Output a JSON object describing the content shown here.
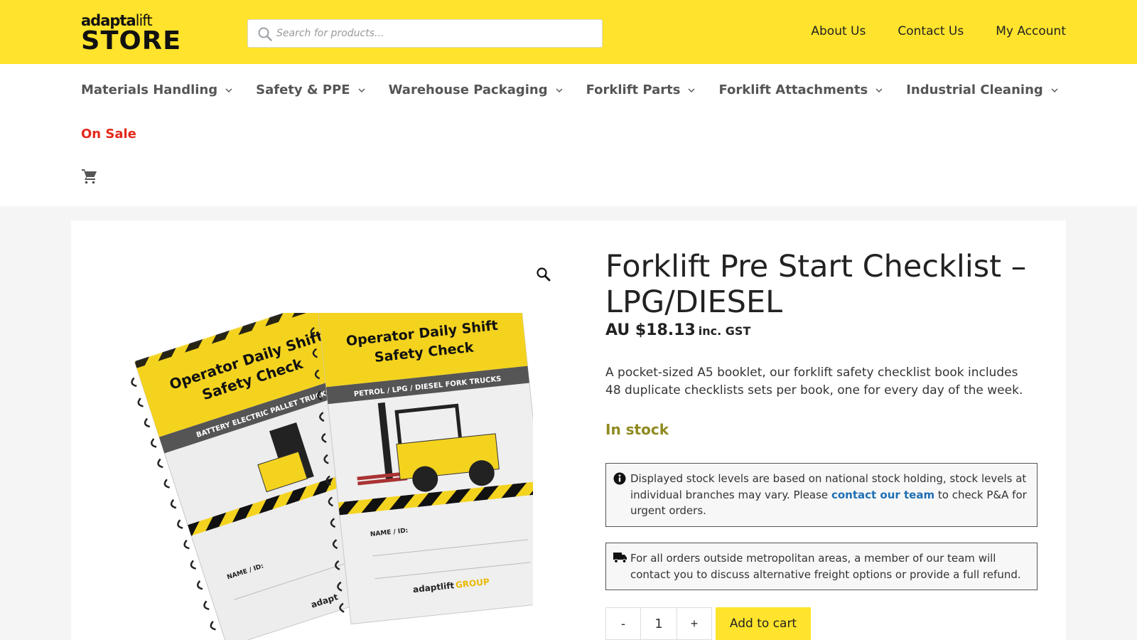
{
  "header": {
    "logo_top_bold": "adapta",
    "logo_top_thin": "lift",
    "logo_bottom": "STORE",
    "search_placeholder": "Search for products...",
    "links": [
      "About Us",
      "Contact Us",
      "My Account"
    ]
  },
  "nav": {
    "items": [
      "Materials Handling",
      "Safety & PPE",
      "Warehouse Packaging",
      "Forklift Parts",
      "Forklift Attachments",
      "Industrial Cleaning"
    ],
    "sale_label": "On Sale"
  },
  "product": {
    "title": "Forklift Pre Start Checklist – LPG/DIESEL",
    "price": "AU $18.13",
    "price_suffix": "inc. GST",
    "description": "A pocket-sized A5 booklet, our forklift safety checklist book includes 48 duplicate checklists sets per book, one for every day of the week.",
    "stock_status": "In stock",
    "quantity": "1",
    "minus_label": "-",
    "plus_label": "+",
    "add_to_cart_label": "Add to cart",
    "image": {
      "book1_title_l1": "Operator Daily Shift",
      "book1_title_l2": "Safety Check",
      "book1_subtitle": "BATTERY ELECTRIC PALLET TRUCKS",
      "book1_name": "NAME / ID:",
      "book1_brand": "adapt",
      "book2_title_l1": "Operator Daily Shift",
      "book2_title_l2": "Safety Check",
      "book2_subtitle": "PETROL / LPG / DIESEL FORK TRUCKS",
      "book2_name": "NAME / ID:",
      "book2_brand": "adaptlift",
      "book2_brand_group": "GROUP"
    }
  },
  "notices": {
    "stock_text_before": "Displayed stock levels are based on national stock holding, stock levels at individual branches may vary. Please",
    "stock_link": "contact our team",
    "stock_text_after": "to check P&A for urgent orders.",
    "freight_text": "For all orders outside metropolitan areas, a member of our team will contact you to discuss alternative freight options or provide a full refund."
  },
  "colors": {
    "brand_yellow": "#ffe32c",
    "sale_red": "#e3291b",
    "stock_olive": "#8f8a1f",
    "link_blue": "#1f6fb4"
  }
}
